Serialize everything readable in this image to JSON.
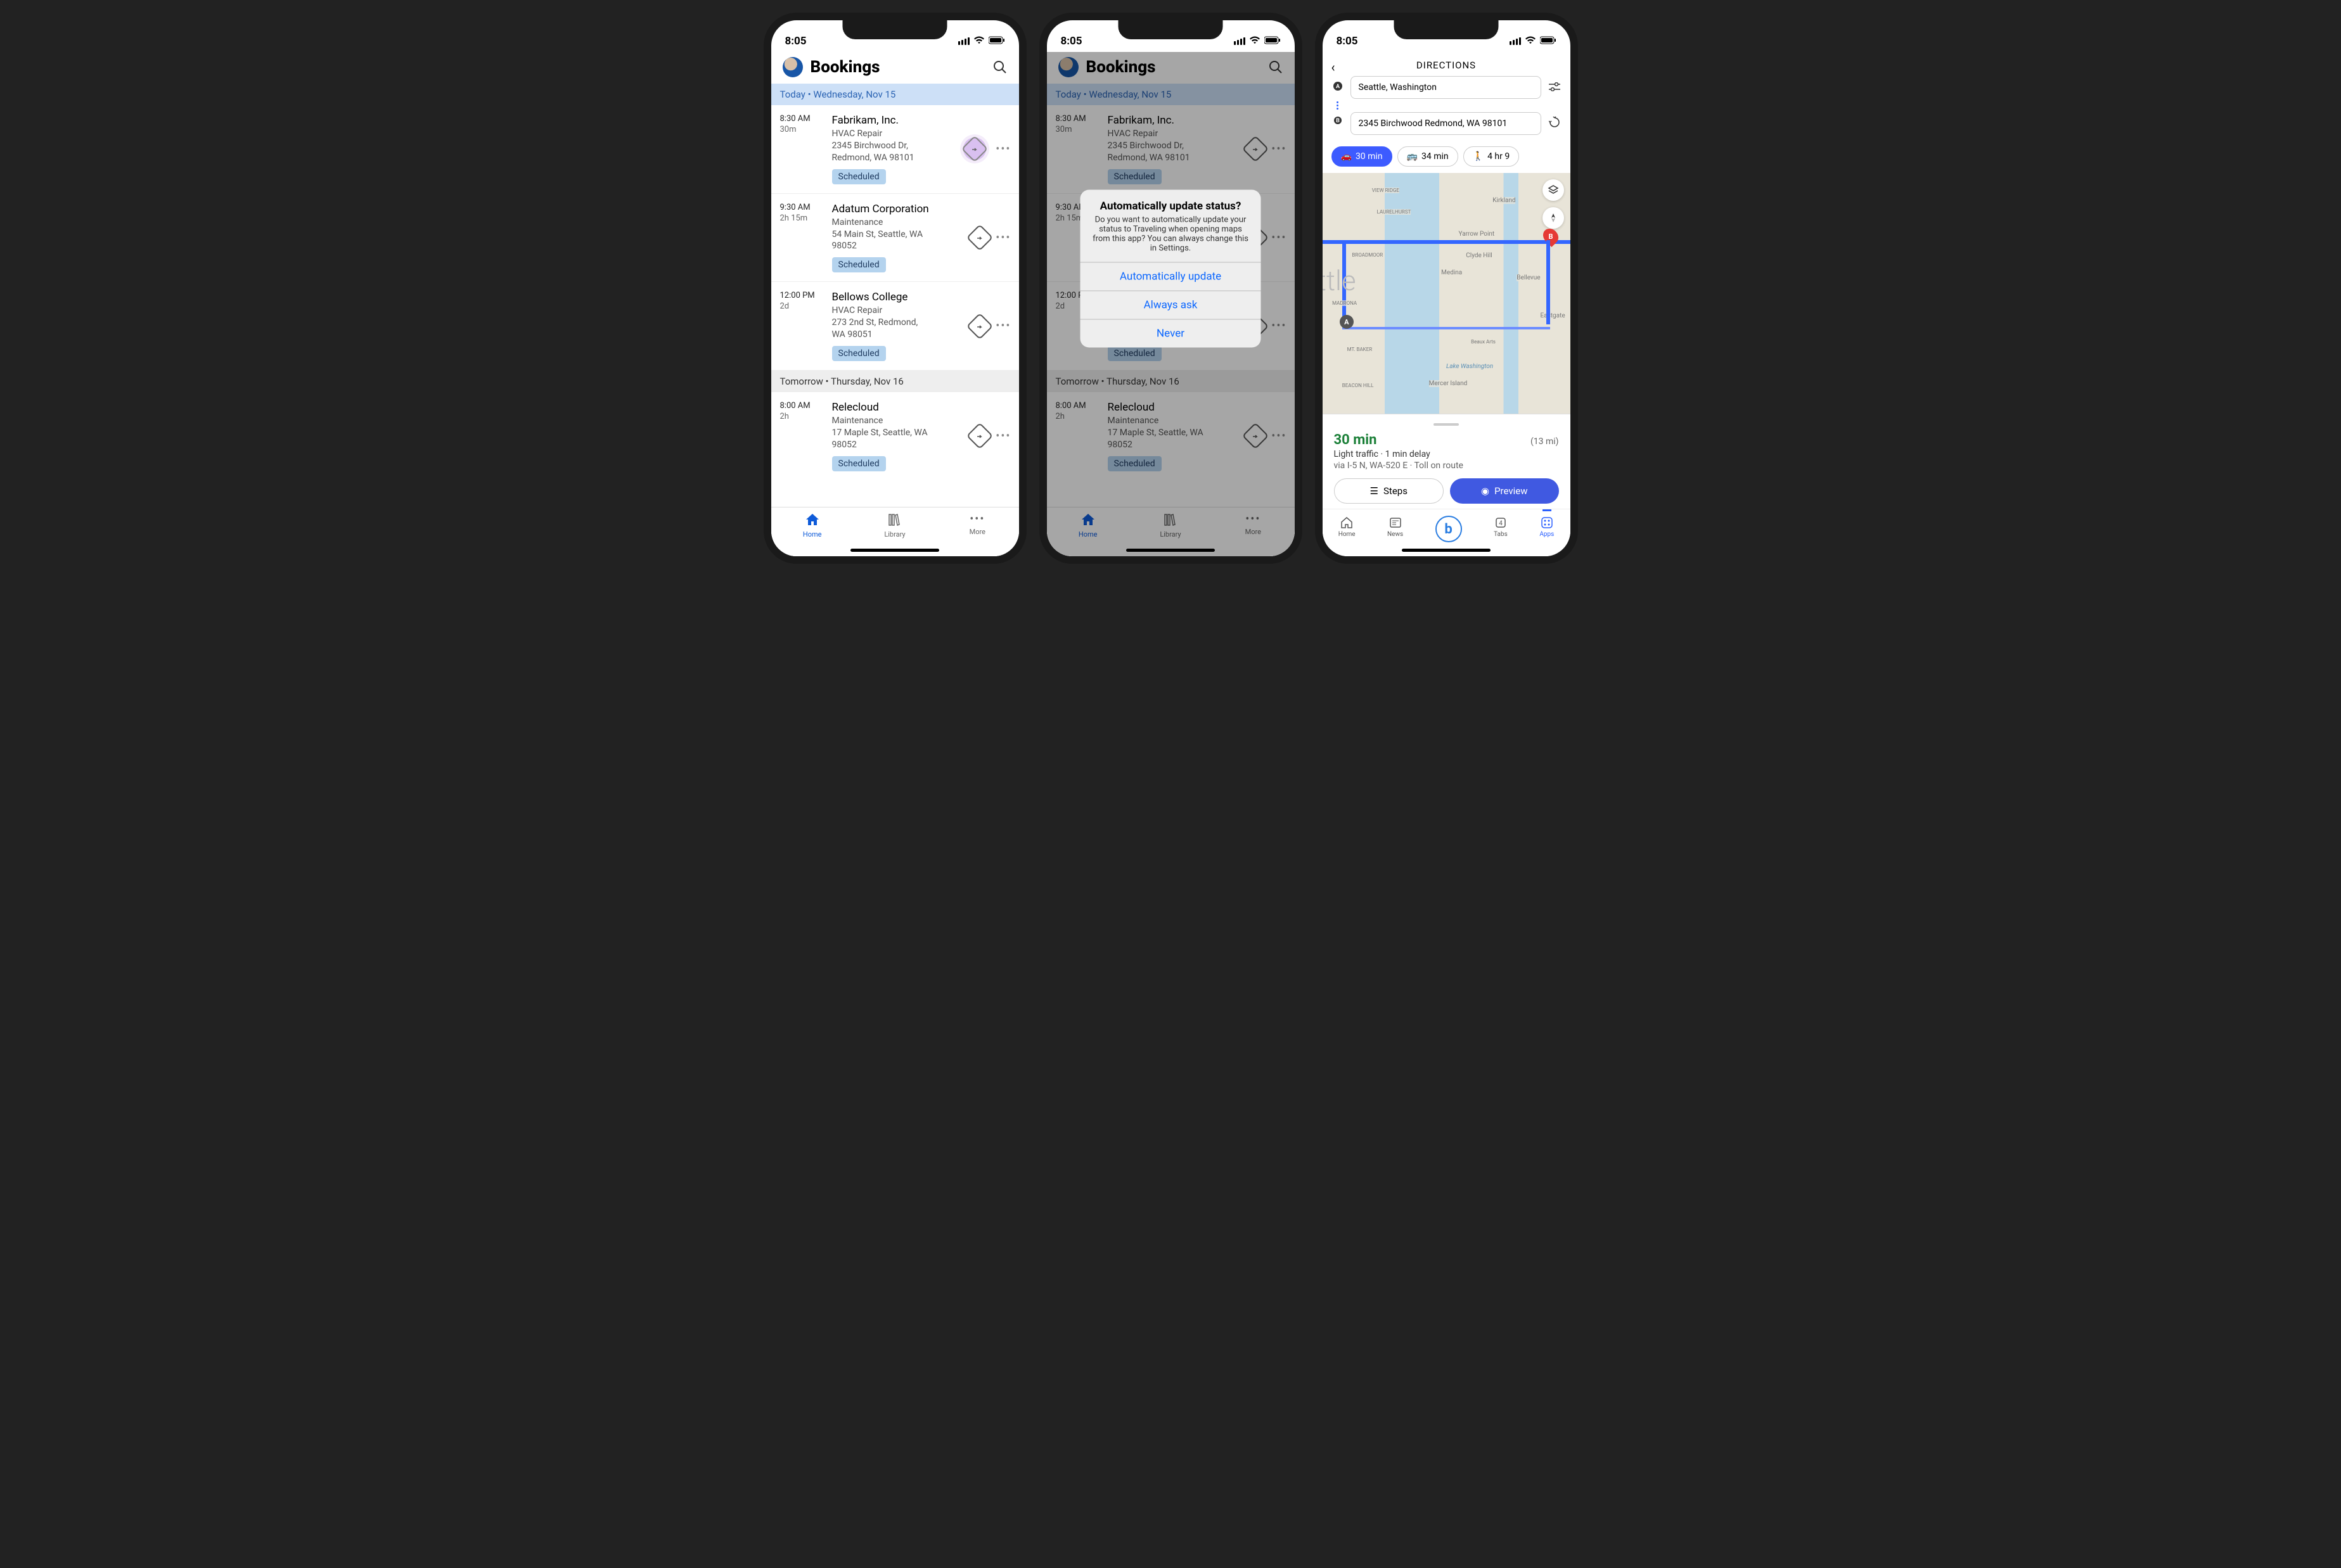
{
  "status": {
    "time": "8:05"
  },
  "bookings": {
    "title": "Bookings",
    "today_label": "Today • Wednesday, Nov 15",
    "tomorrow_label": "Tomorrow • Thursday, Nov 16",
    "items": [
      {
        "time": "8:30 AM",
        "dur": "30m",
        "name": "Fabrikam, Inc.",
        "job": "HVAC Repair",
        "addr1": "2345 Birchwood Dr,",
        "addr2": "Redmond, WA 98101",
        "status": "Scheduled"
      },
      {
        "time": "9:30 AM",
        "dur": "2h 15m",
        "name": "Adatum Corporation",
        "job": "Maintenance",
        "addr1": "54 Main St, Seattle, WA",
        "addr2": "98052",
        "status": "Scheduled"
      },
      {
        "time": "12:00 PM",
        "dur": "2d",
        "name": "Bellows College",
        "job": "HVAC Repair",
        "addr1": "273 2nd St, Redmond,",
        "addr2": "WA 98051",
        "status": "Scheduled"
      },
      {
        "time": "8:00 AM",
        "dur": "2h",
        "name": "Relecloud",
        "job": "Maintenance",
        "addr1": "17 Maple St, Seattle, WA",
        "addr2": "98052",
        "status": "Scheduled"
      }
    ]
  },
  "tabs": {
    "home": "Home",
    "library": "Library",
    "more": "More"
  },
  "dialog": {
    "title": "Automatically update status?",
    "message": "Do you want to automatically update your status to Traveling when opening maps from this app? You can always change this in Settings.",
    "opt1": "Automatically update",
    "opt2": "Always ask",
    "opt3": "Never"
  },
  "directions": {
    "title": "DIRECTIONS",
    "from": "Seattle, Washington",
    "to": "2345 Birchwood Redmond, WA 98101",
    "modes": {
      "car": "30 min",
      "transit": "34 min",
      "walk": "4 hr 9"
    },
    "map_labels": {
      "kirkland": "Kirkland",
      "bellevue": "Bellevue",
      "medina": "Medina",
      "clyde": "Clyde Hill",
      "yarrow": "Yarrow Point",
      "mercer": "Mercer Island",
      "eastgate": "Eastgate",
      "laurelhurst": "LAURELHURST",
      "viewridge": "VIEW RIDGE",
      "madrona": "MADRONA",
      "beacon": "BEACON HILL",
      "lakewa": "Lake Washington",
      "seattle_big": "ttle",
      "broadmoor": "BROADMOOR",
      "mtbaker": "MT. BAKER",
      "beaux": "Beaux Arts"
    },
    "summary": {
      "time": "30 min",
      "dist": "(13 mi)",
      "traffic": "Light traffic · 1 min delay",
      "route": "via I-5 N, WA-520 E · Toll on route"
    },
    "buttons": {
      "steps": "Steps",
      "preview": "Preview"
    },
    "bottom_tabs": {
      "home": "Home",
      "news": "News",
      "tabs": "Tabs",
      "tabs_count": "4",
      "apps": "Apps"
    }
  }
}
